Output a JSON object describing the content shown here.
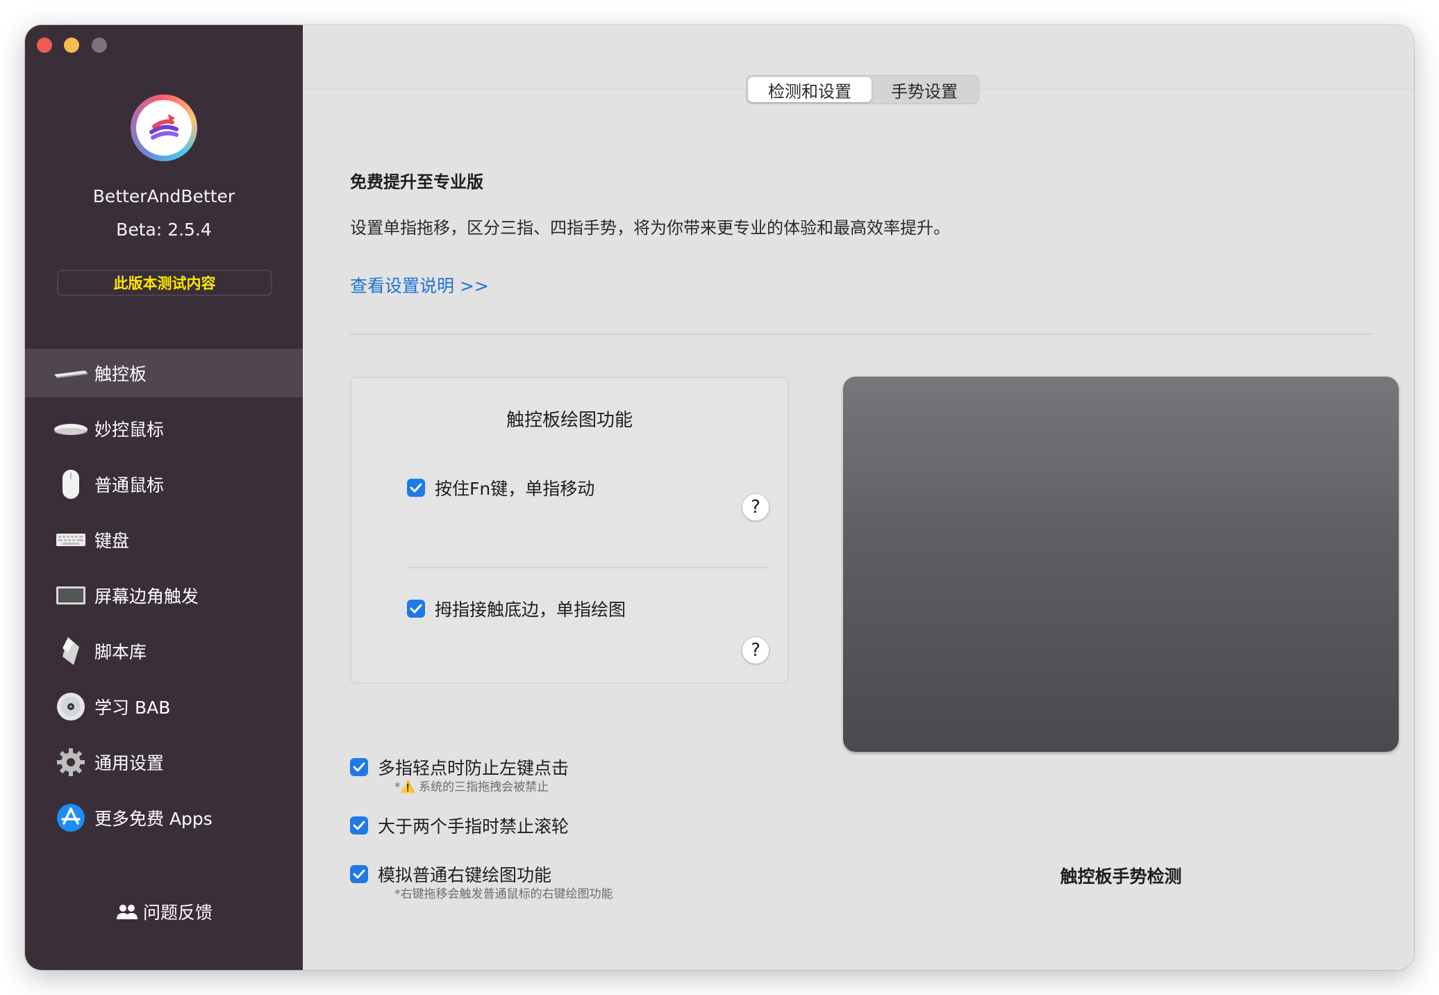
{
  "sidebar": {
    "app_name": "BetterAndBetter",
    "version": "Beta: 2.5.4",
    "beta_badge": "此版本测试内容",
    "items": [
      {
        "label": "触控板",
        "icon": "trackpad-icon",
        "active": true
      },
      {
        "label": "妙控鼠标",
        "icon": "magic-mouse-icon",
        "active": false
      },
      {
        "label": "普通鼠标",
        "icon": "mouse-icon",
        "active": false
      },
      {
        "label": "键盘",
        "icon": "keyboard-icon",
        "active": false
      },
      {
        "label": "屏幕边角触发",
        "icon": "screen-corner-icon",
        "active": false
      },
      {
        "label": "脚本库",
        "icon": "script-icon",
        "active": false
      },
      {
        "label": "学习 BAB",
        "icon": "disc-icon",
        "active": false
      },
      {
        "label": "通用设置",
        "icon": "gear-icon",
        "active": false
      },
      {
        "label": "更多免费 Apps",
        "icon": "app-store-icon",
        "active": false
      }
    ],
    "feedback": "问题反馈"
  },
  "tabs": [
    {
      "label": "检测和设置",
      "active": true
    },
    {
      "label": "手势设置",
      "active": false
    }
  ],
  "promo": {
    "title": "免费提升至专业版",
    "description": "设置单指拖移，区分三指、四指手势，将为你带来更专业的体验和最高效率提升。",
    "link": "查看设置说明 >>"
  },
  "draw_box": {
    "title": "触控板绘图功能",
    "options": [
      {
        "label": "按住Fn键，单指移动",
        "checked": true,
        "help": "?"
      },
      {
        "label": "拇指接触底边，单指绘图",
        "checked": true,
        "help": "?"
      }
    ]
  },
  "options": [
    {
      "label": "多指轻点时防止左键点击",
      "checked": true,
      "note": "*⚠️ 系统的三指拖拽会被禁止"
    },
    {
      "label": "大于两个手指时禁止滚轮",
      "checked": true,
      "note": ""
    },
    {
      "label": "模拟普通右键绘图功能",
      "checked": true,
      "note": "*右键拖移会触发普通鼠标的右键绘图功能"
    }
  ],
  "trackpad_caption": "触控板手势检测",
  "colors": {
    "sidebar_bg": "#3a2f38",
    "accent": "#1f7ae8",
    "link": "#1d72d8",
    "badge_text": "#ffe800"
  }
}
